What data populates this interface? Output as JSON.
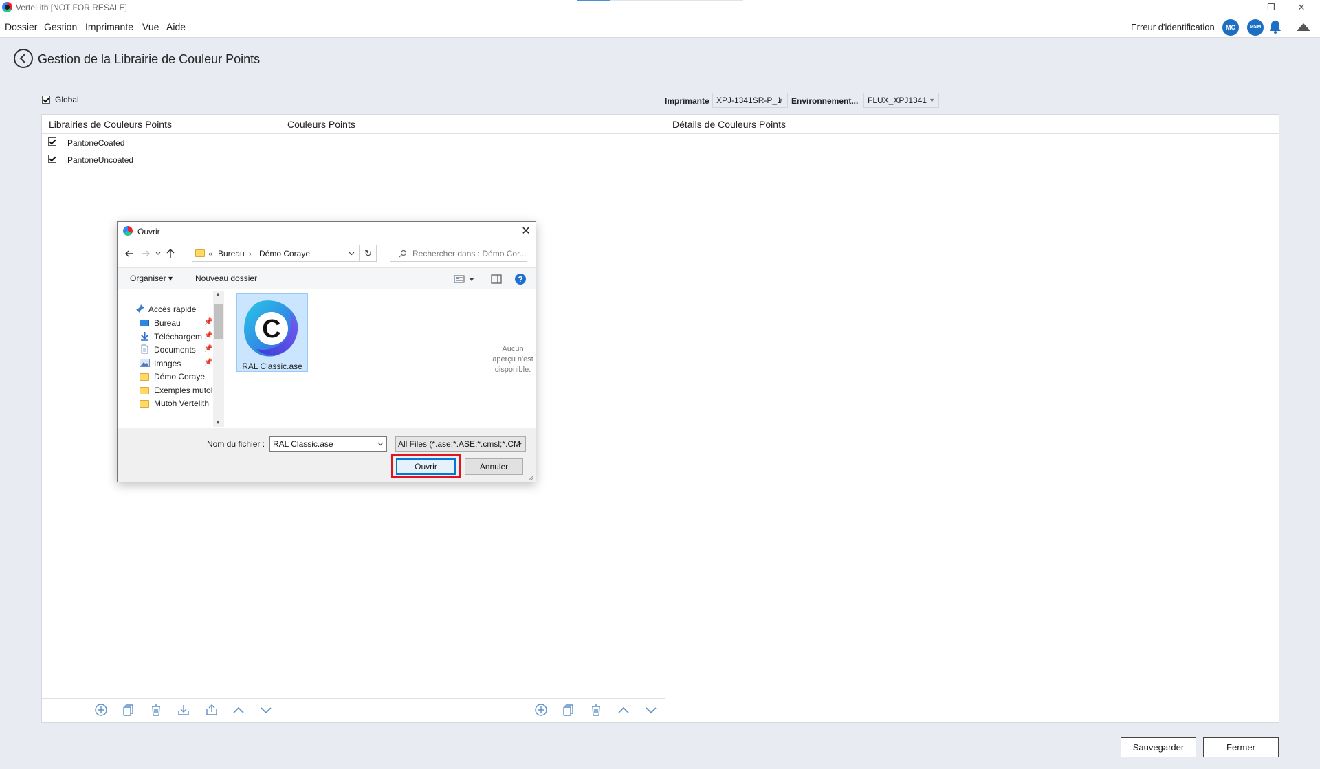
{
  "app": {
    "title": "VerteLith [NOT FOR RESALE]",
    "window_controls": {
      "minimize": "—",
      "restore": "❐",
      "close": "✕"
    }
  },
  "menu": {
    "items": [
      "Dossier",
      "Gestion",
      "Imprimante",
      "Vue",
      "Aide"
    ],
    "ident_error": "Erreur d'identification",
    "badges": [
      "MC",
      "MSM"
    ]
  },
  "page": {
    "title": "Gestion de la Librairie de Couleur Points",
    "global_label": "Global",
    "printer_label": "Imprimante",
    "printer_value": "XPJ-1341SR-P_1",
    "env_label": "Environnement...",
    "env_value": "FLUX_XPJ1341"
  },
  "panels": {
    "libraries": {
      "header": "Librairies de Couleurs Points",
      "items": [
        {
          "label": "PantoneCoated",
          "checked": true
        },
        {
          "label": "PantoneUncoated",
          "checked": true
        }
      ]
    },
    "colors": {
      "header": "Couleurs Points"
    },
    "details": {
      "header": "Détails de Couleurs Points"
    }
  },
  "footer": {
    "save": "Sauvegarder",
    "close": "Fermer"
  },
  "dialog": {
    "title": "Ouvrir",
    "breadcrumb": [
      "«",
      "Bureau",
      "›",
      "Démo Coraye"
    ],
    "search_placeholder": "Rechercher dans : Démo Cor...",
    "organize": "Organiser ▾",
    "new_folder": "Nouveau dossier",
    "tree": [
      {
        "label": "Accès rapide",
        "icon": "pin-icon"
      },
      {
        "label": "Bureau",
        "icon": "desktop-icon"
      },
      {
        "label": "Téléchargeme",
        "icon": "download-icon"
      },
      {
        "label": "Documents",
        "icon": "document-icon"
      },
      {
        "label": "Images",
        "icon": "image-icon"
      },
      {
        "label": "Démo Coraye",
        "icon": "folder-icon"
      },
      {
        "label": "Exemples mutoh",
        "icon": "folder-icon"
      },
      {
        "label": "Mutoh Vertelith",
        "icon": "folder-icon"
      }
    ],
    "file": {
      "name": "RAL Classic.ase",
      "icon_letter": "C"
    },
    "preview_text": "Aucun aperçu n'est disponible.",
    "filename_label": "Nom du fichier :",
    "filename_value": "RAL Classic.ase",
    "filter_value": "All Files (*.ase;*.ASE;*.cmsl;*.CM",
    "open_button": "Ouvrir",
    "cancel_button": "Annuler"
  },
  "colors": {
    "background": "#e8ebf1",
    "accent": "#1d6fc4",
    "highlight": "#e0141e"
  }
}
